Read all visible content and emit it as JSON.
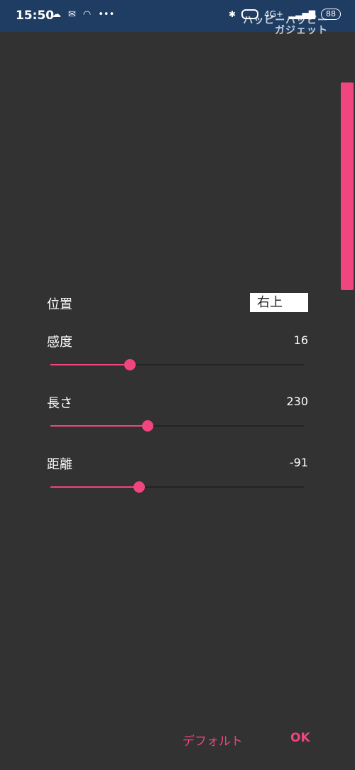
{
  "status_bar": {
    "time": "15:50",
    "network": "4G+",
    "battery": "88",
    "icons_left": [
      "mail-icon",
      "hotspot-icon",
      "more-dots-icon"
    ],
    "icons_right": [
      "bluetooth-icon",
      "ring-icon",
      "signal-icon",
      "battery-icon"
    ]
  },
  "watermark": [
    "ハッピーハッピー",
    "ガジェット"
  ],
  "settings": {
    "position": {
      "label": "位置",
      "value": "右上"
    },
    "sensitivity": {
      "label": "感度",
      "value": "16",
      "fraction": 0.315
    },
    "length": {
      "label": "長さ",
      "value": "230",
      "fraction": 0.383
    },
    "distance": {
      "label": "距離",
      "value": "-91",
      "fraction": 0.35
    }
  },
  "buttons": {
    "default_label": "デフォルト",
    "ok_label": "OK"
  },
  "colors": {
    "accent": "#f0457e",
    "background": "#323232",
    "status_bar": "#1f3d63"
  }
}
